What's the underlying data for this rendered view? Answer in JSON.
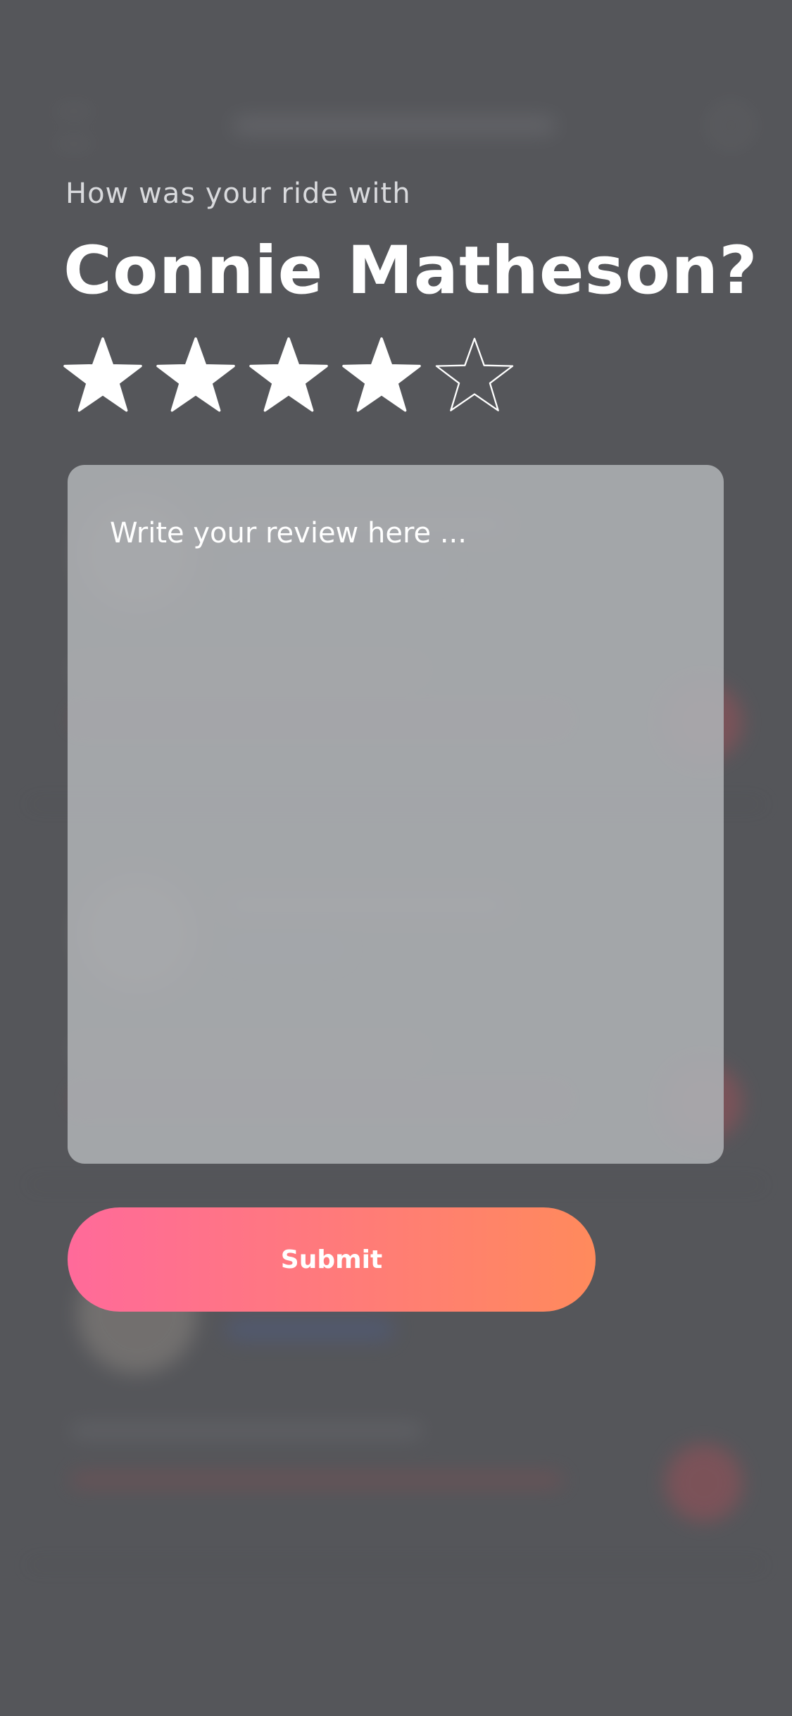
{
  "rating_sheet": {
    "prompt": "How was your ride with",
    "driver_name": "Connie Matheson?",
    "rating": 4,
    "max_rating": 5,
    "review_placeholder": "Write your review here ...",
    "submit_label": "Submit"
  },
  "colors": {
    "overlay": "#55565a",
    "star_filled": "#ffffff",
    "review_box": "#aaacb0",
    "submit_gradient_start": "#ff6a9a",
    "submit_gradient_end": "#ff8a5c"
  },
  "icons": {
    "star_filled": "star-filled-icon",
    "star_outline": "star-outline-icon"
  }
}
